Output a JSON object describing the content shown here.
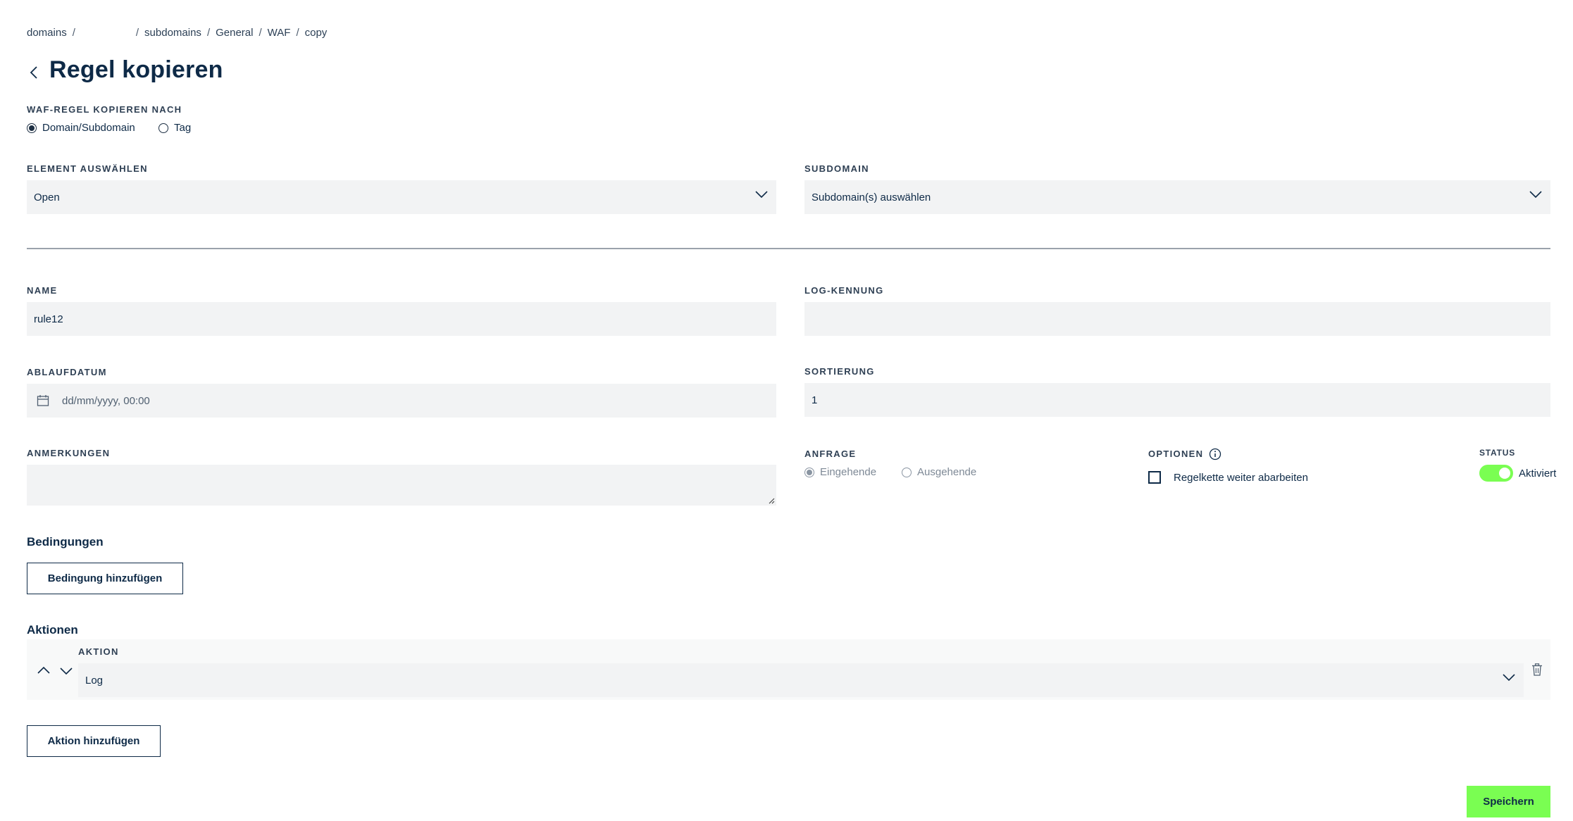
{
  "breadcrumb": {
    "items": [
      "domains",
      "",
      "subdomains",
      "General",
      "WAF",
      "copy"
    ],
    "separator": "/"
  },
  "page": {
    "title": "Regel kopieren"
  },
  "copy_target": {
    "label": "WAF-REGEL KOPIEREN NACH",
    "options": [
      "Domain/Subdomain",
      "Tag"
    ],
    "selected": "Domain/Subdomain"
  },
  "element_select": {
    "label": "ELEMENT AUSWÄHLEN",
    "value": "Open"
  },
  "subdomain_select": {
    "label": "SUBDOMAIN",
    "value": "Subdomain(s) auswählen"
  },
  "name_field": {
    "label": "NAME",
    "value": "rule12"
  },
  "log_field": {
    "label": "LOG-KENNUNG",
    "value": ""
  },
  "expiry_field": {
    "label": "ABLAUFDATUM",
    "placeholder": "dd/mm/yyyy, 00:00"
  },
  "sort_field": {
    "label": "SORTIERUNG",
    "value": "1"
  },
  "notes_field": {
    "label": "ANMERKUNGEN",
    "value": ""
  },
  "request": {
    "label": "ANFRAGE",
    "options": [
      "Eingehende",
      "Ausgehende"
    ],
    "selected": "Eingehende"
  },
  "options": {
    "label": "OPTIONEN",
    "checkbox_label": "Regelkette weiter abarbeiten",
    "checked": false
  },
  "status": {
    "label": "STATUS",
    "toggle_label": "Aktiviert",
    "enabled": true
  },
  "conditions": {
    "title": "Bedingungen",
    "add_button": "Bedingung hinzufügen"
  },
  "actions": {
    "title": "Aktionen",
    "field_label": "AKTION",
    "items": [
      {
        "value": "Log"
      }
    ],
    "add_button": "Aktion hinzufügen"
  },
  "footer": {
    "save_button": "Speichern"
  },
  "colors": {
    "accent": "#7afe52",
    "text": "#0e2a47",
    "field_bg": "#f2f3f4"
  }
}
